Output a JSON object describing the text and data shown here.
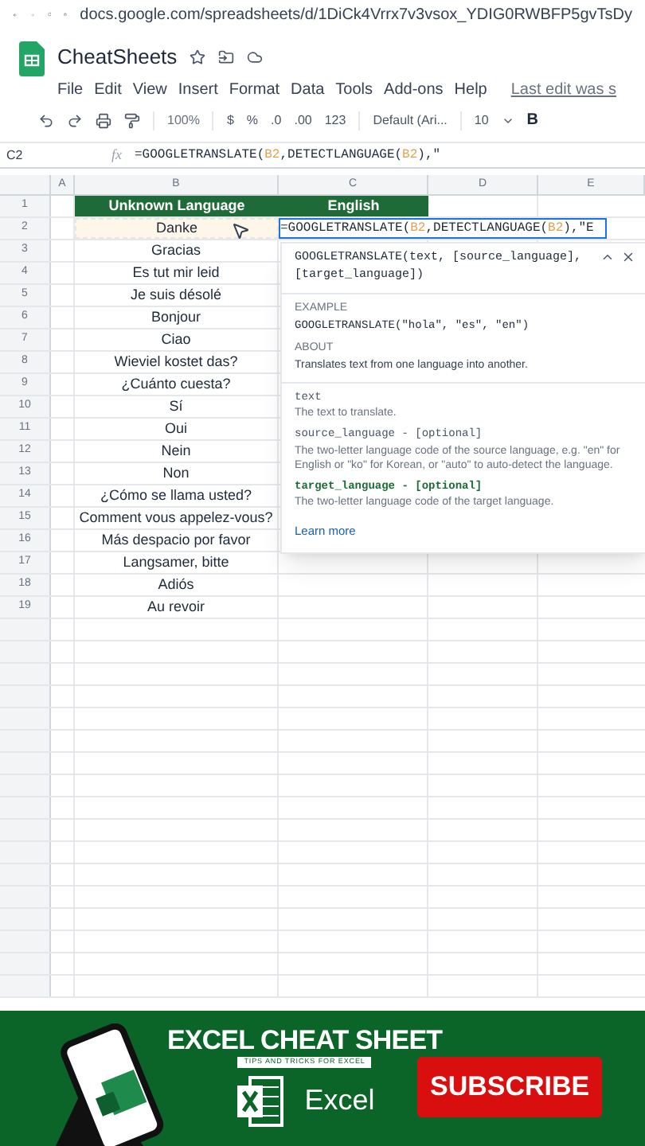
{
  "browser": {
    "url": "docs.google.com/spreadsheets/d/1DiCk4Vrrx7v3vsox_YDIG0RWBFP5gvTsDy"
  },
  "doc": {
    "title": "CheatSheets",
    "menus": [
      "File",
      "Edit",
      "View",
      "Insert",
      "Format",
      "Data",
      "Tools",
      "Add-ons",
      "Help"
    ],
    "last_edit": "Last edit was s"
  },
  "toolbar": {
    "zoom": "100%",
    "currency": "$",
    "percent": "%",
    "decimal_less": ".0",
    "decimal_more": ".00",
    "number_format": "123",
    "font": "Default (Ari...",
    "font_size": "10",
    "bold": "B"
  },
  "formula_bar": {
    "cell": "C2",
    "fx": "fx",
    "formula": [
      {
        "text": "=GOOGLETRANSLATE(",
        "ref": false
      },
      {
        "text": "B2",
        "ref": true
      },
      {
        "text": ",DETECTLANGUAGE(",
        "ref": false
      },
      {
        "text": "B2",
        "ref": true
      },
      {
        "text": "),\"",
        "ref": false
      }
    ]
  },
  "columns": [
    "A",
    "B",
    "C",
    "D",
    "E"
  ],
  "rows": [
    {
      "number": "1",
      "kind": "header",
      "b": "Unknown Language",
      "c": "English",
      "referenced": false
    },
    {
      "number": "2",
      "kind": "editing",
      "b": "Danke",
      "c": [
        {
          "text": "=GOOGLETRANSLATE(",
          "ref": false
        },
        {
          "text": "B2",
          "ref": true
        },
        {
          "text": ",DETECTLANGUAGE(",
          "ref": false
        },
        {
          "text": "B2",
          "ref": true
        },
        {
          "text": "),\"E",
          "ref": false
        }
      ],
      "referenced": true
    },
    {
      "number": "3",
      "kind": "data",
      "b": "Gracias",
      "referenced": false
    },
    {
      "number": "4",
      "kind": "data",
      "b": "Es tut mir leid",
      "referenced": false
    },
    {
      "number": "5",
      "kind": "data",
      "b": "Je suis désolé",
      "referenced": false
    },
    {
      "number": "6",
      "kind": "data",
      "b": "Bonjour",
      "referenced": false
    },
    {
      "number": "7",
      "kind": "data",
      "b": "Ciao",
      "referenced": false
    },
    {
      "number": "8",
      "kind": "data",
      "b": "Wieviel kostet das?",
      "referenced": false
    },
    {
      "number": "9",
      "kind": "data",
      "b": "¿Cuánto cuesta?",
      "referenced": false
    },
    {
      "number": "10",
      "kind": "data",
      "b": "Sí",
      "referenced": false
    },
    {
      "number": "11",
      "kind": "data",
      "b": "Oui",
      "referenced": false
    },
    {
      "number": "12",
      "kind": "data",
      "b": "Nein",
      "referenced": false
    },
    {
      "number": "13",
      "kind": "data",
      "b": "Non",
      "referenced": false
    },
    {
      "number": "14",
      "kind": "data",
      "b": "¿Cómo se llama usted?",
      "referenced": false
    },
    {
      "number": "15",
      "kind": "data",
      "b": "Comment vous appelez-vous?",
      "referenced": false
    },
    {
      "number": "16",
      "kind": "data",
      "b": "Más despacio por favor",
      "referenced": false
    },
    {
      "number": "17",
      "kind": "data",
      "b": "Langsamer, bitte",
      "referenced": false
    },
    {
      "number": "18",
      "kind": "data",
      "b": "Adiós",
      "referenced": false
    },
    {
      "number": "19",
      "kind": "data",
      "b": "Au revoir",
      "referenced": false
    }
  ],
  "popup": {
    "signature": "GOOGLETRANSLATE(text, [source_language],",
    "signature_2": "[target_language])",
    "example_label": "EXAMPLE",
    "example": "GOOGLETRANSLATE(\"hola\", \"es\", \"en\")",
    "about_label": "ABOUT",
    "about": "Translates text from one language into another.",
    "params": [
      {
        "name": "text",
        "description": "The text to translate.",
        "bold": false
      },
      {
        "name": "source_language - [optional]",
        "description": "The two-letter language code of the source language, e.g. \"en\" for English or \"ko\" for Korean, or \"auto\" to auto-detect the language.",
        "bold": false
      },
      {
        "name": "target_language - [optional]",
        "description": "The two-letter language code of the target language.",
        "bold": true
      }
    ],
    "learn_more": "Learn more"
  },
  "banner": {
    "title": "EXCEL CHEAT SHEET",
    "tagline": "TIPS AND TRICKS FOR EXCEL",
    "app": "Excel",
    "subscribe": "SUBSCRIBE"
  }
}
